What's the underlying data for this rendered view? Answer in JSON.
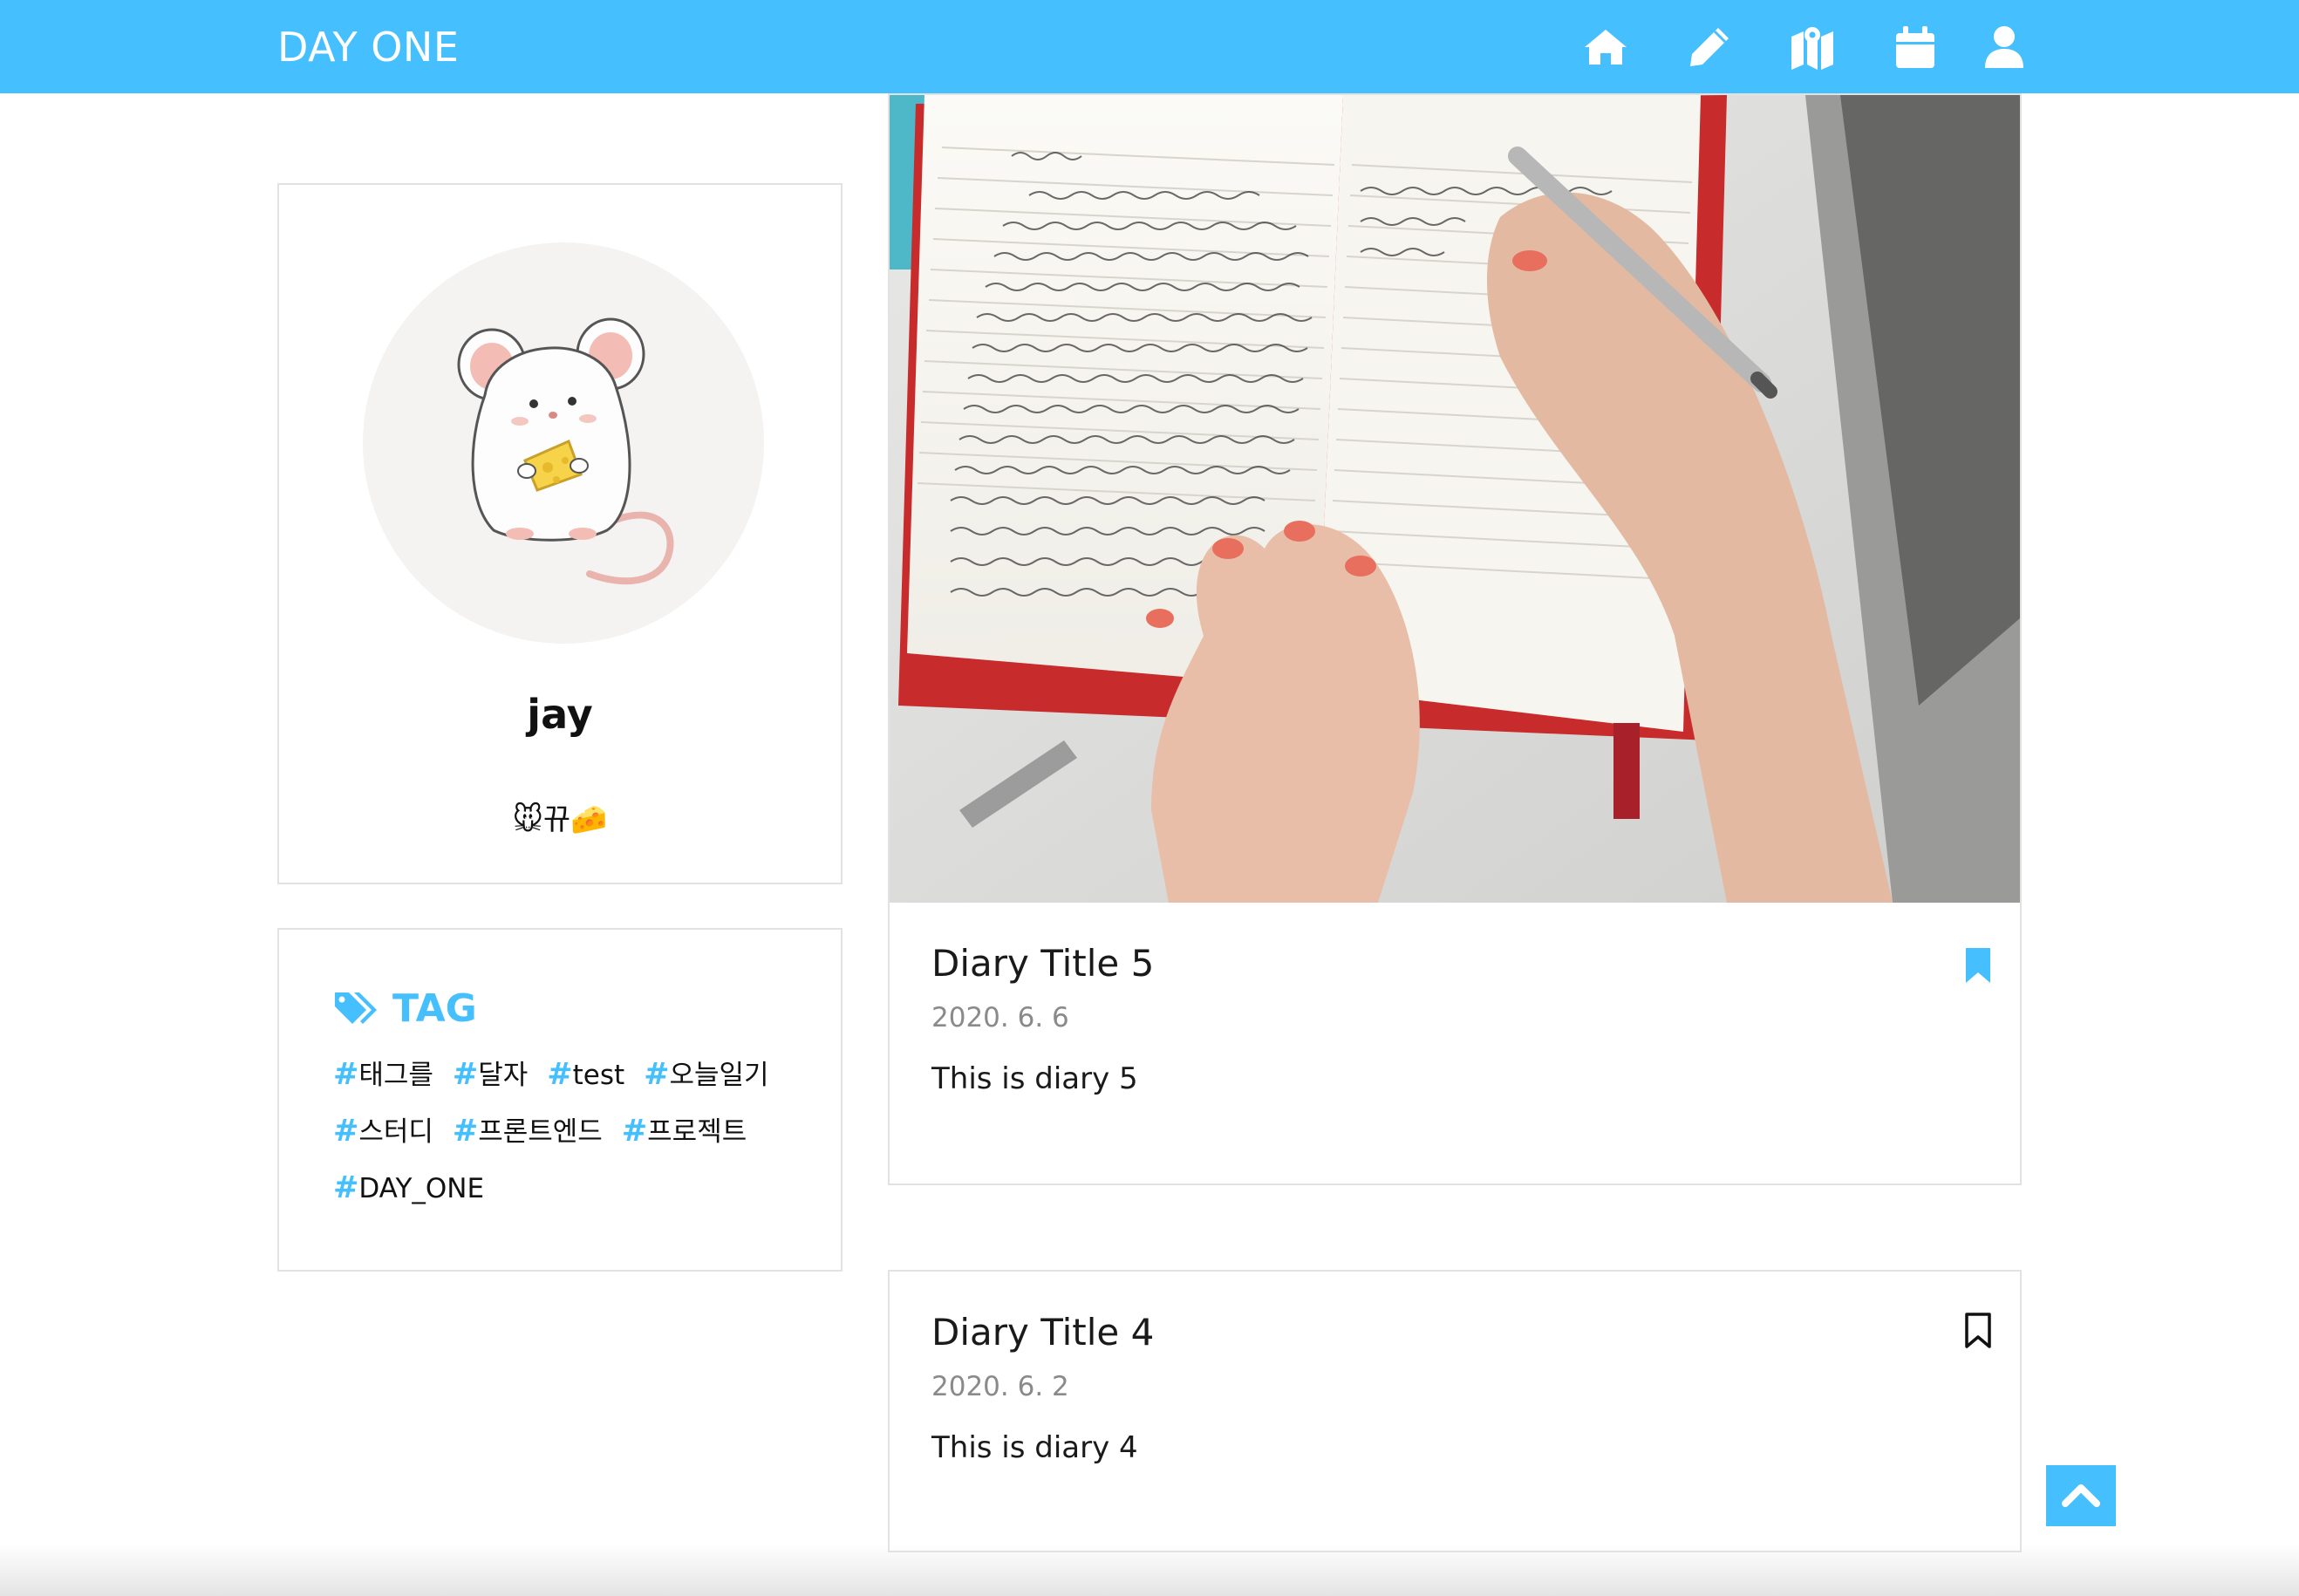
{
  "header": {
    "logo": "DAY ONE",
    "nav_icons": [
      "home-icon",
      "pencil-icon",
      "map-icon",
      "calendar-icon",
      "user-icon"
    ]
  },
  "profile": {
    "avatar_icon": "mouse-with-cheese-illustration",
    "username": "jay",
    "bio": "🐭뀨🧀"
  },
  "tags": {
    "title": "TAG",
    "icon": "tags-icon",
    "hash": "#",
    "items": [
      "태그를",
      "달자",
      "test",
      "오늘일기",
      "스터디",
      "프론트엔드",
      "프로젝트",
      "DAY_ONE"
    ]
  },
  "diaries": [
    {
      "title": "Diary Title 5",
      "date": "2020. 6. 6",
      "excerpt": "This is diary 5",
      "bookmarked": true,
      "has_image": true
    },
    {
      "title": "Diary Title 4",
      "date": "2020. 6. 2",
      "excerpt": "This is diary 4",
      "bookmarked": false,
      "has_image": false
    }
  ],
  "colors": {
    "accent": "#45bffd",
    "text": "#1a1a1a",
    "muted": "#8a8a8a",
    "border": "#e2e2e2"
  },
  "scroll_top": {
    "icon": "chevron-up-icon"
  }
}
